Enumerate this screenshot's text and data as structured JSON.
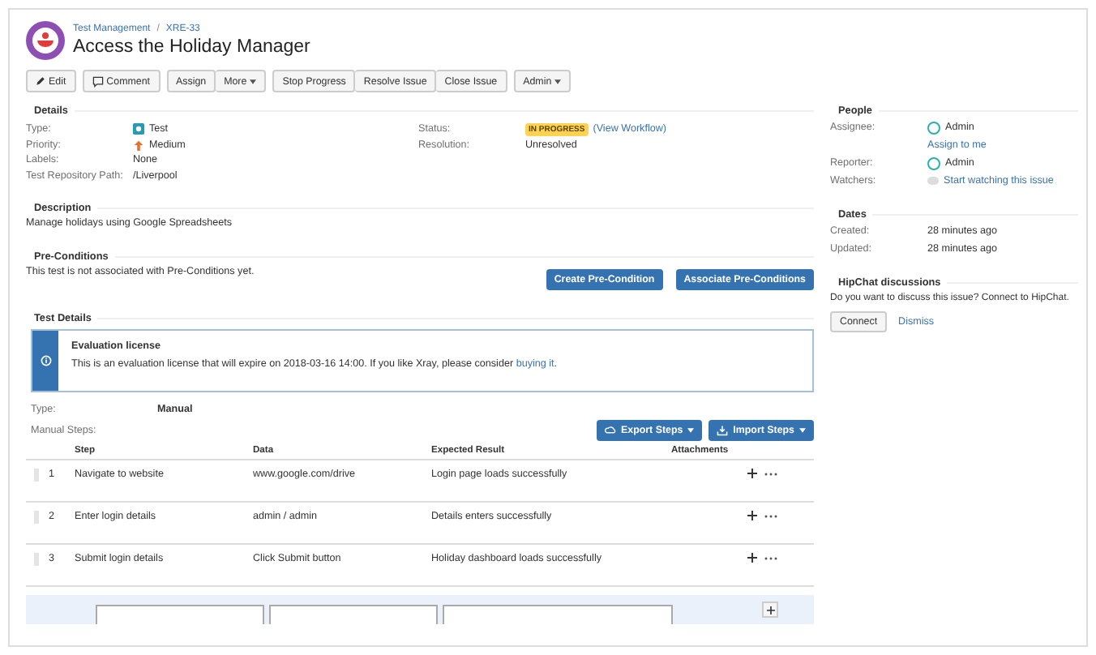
{
  "breadcrumb": {
    "project": "Test Management",
    "separator": "/",
    "key": "XRE-33"
  },
  "title": "Access the Holiday Manager",
  "toolbar": [
    [
      {
        "label": "Edit",
        "kind": "pencil"
      }
    ],
    [
      {
        "label": "Comment",
        "kind": "comment"
      }
    ],
    [
      {
        "label": "Assign",
        "kind": "plain"
      },
      {
        "label": "More",
        "kind": "menu"
      }
    ],
    [
      {
        "label": "Stop Progress",
        "kind": "plain"
      },
      {
        "label": "Resolve Issue",
        "kind": "plain"
      },
      {
        "label": "Close Issue",
        "kind": "plain"
      }
    ],
    [
      {
        "label": "Admin",
        "kind": "menu"
      }
    ]
  ],
  "details": {
    "heading": "Details",
    "left": [
      {
        "label": "Type:",
        "value": "Test",
        "kind": "type"
      },
      {
        "label": "Priority:",
        "value": "Medium",
        "kind": "priority"
      },
      {
        "label": "Labels:",
        "value": "None",
        "kind": "text"
      },
      {
        "label": "Test Repository Path:",
        "value": "/Liverpool",
        "kind": "text"
      }
    ],
    "right": [
      {
        "label": "Status:",
        "value": "IN PROGRESS",
        "link": "(View Workflow)",
        "kind": "status"
      },
      {
        "label": "Resolution:",
        "value": "Unresolved",
        "kind": "text"
      }
    ]
  },
  "description": {
    "heading": "Description",
    "text": "Manage holidays using Google Spreadsheets"
  },
  "preconditions": {
    "heading": "Pre-Conditions",
    "text": "This test is not associated with Pre-Conditions yet.",
    "buttons": [
      "Create Pre-Condition",
      "Associate Pre-Conditions"
    ]
  },
  "test_details": {
    "heading": "Test Details",
    "notice": {
      "title": "Evaluation license",
      "text": "This is an evaluation license that will expire on 2018-03-16 14:00. If you like Xray, please consider ",
      "link": "buying it",
      "end": "."
    },
    "type_label": "Type:",
    "type_value": "Manual",
    "steps_label": "Manual Steps:",
    "buttons": [
      {
        "label": "Export Steps",
        "kind": "export"
      },
      {
        "label": "Import Steps",
        "kind": "import"
      }
    ],
    "columns": [
      "Step",
      "Data",
      "Expected Result",
      "Attachments"
    ],
    "rows": [
      {
        "number": "1",
        "step": "Navigate to website",
        "data": "www.google.com/drive",
        "result": "Login page loads successfully"
      },
      {
        "number": "2",
        "step": "Enter login details",
        "data": "admin / admin",
        "result": "Details enters successfully"
      },
      {
        "number": "3",
        "step": "Submit login details",
        "data": "Click Submit button",
        "result": "Holiday dashboard loads successfully"
      }
    ]
  },
  "people": {
    "heading": "People",
    "assignee_label": "Assignee:",
    "assignee": "Admin",
    "assign_link": "Assign to me",
    "reporter_label": "Reporter:",
    "reporter": "Admin",
    "watchers_label": "Watchers:",
    "watch_link": "Start watching this issue"
  },
  "dates": {
    "heading": "Dates",
    "rows": [
      {
        "label": "Created:",
        "value": "28 minutes ago"
      },
      {
        "label": "Updated:",
        "value": "28 minutes ago"
      }
    ]
  },
  "hipchat": {
    "heading": "HipChat discussions",
    "text": "Do you want to discuss this issue? Connect to HipChat.",
    "button": "Connect",
    "link": "Dismiss"
  }
}
